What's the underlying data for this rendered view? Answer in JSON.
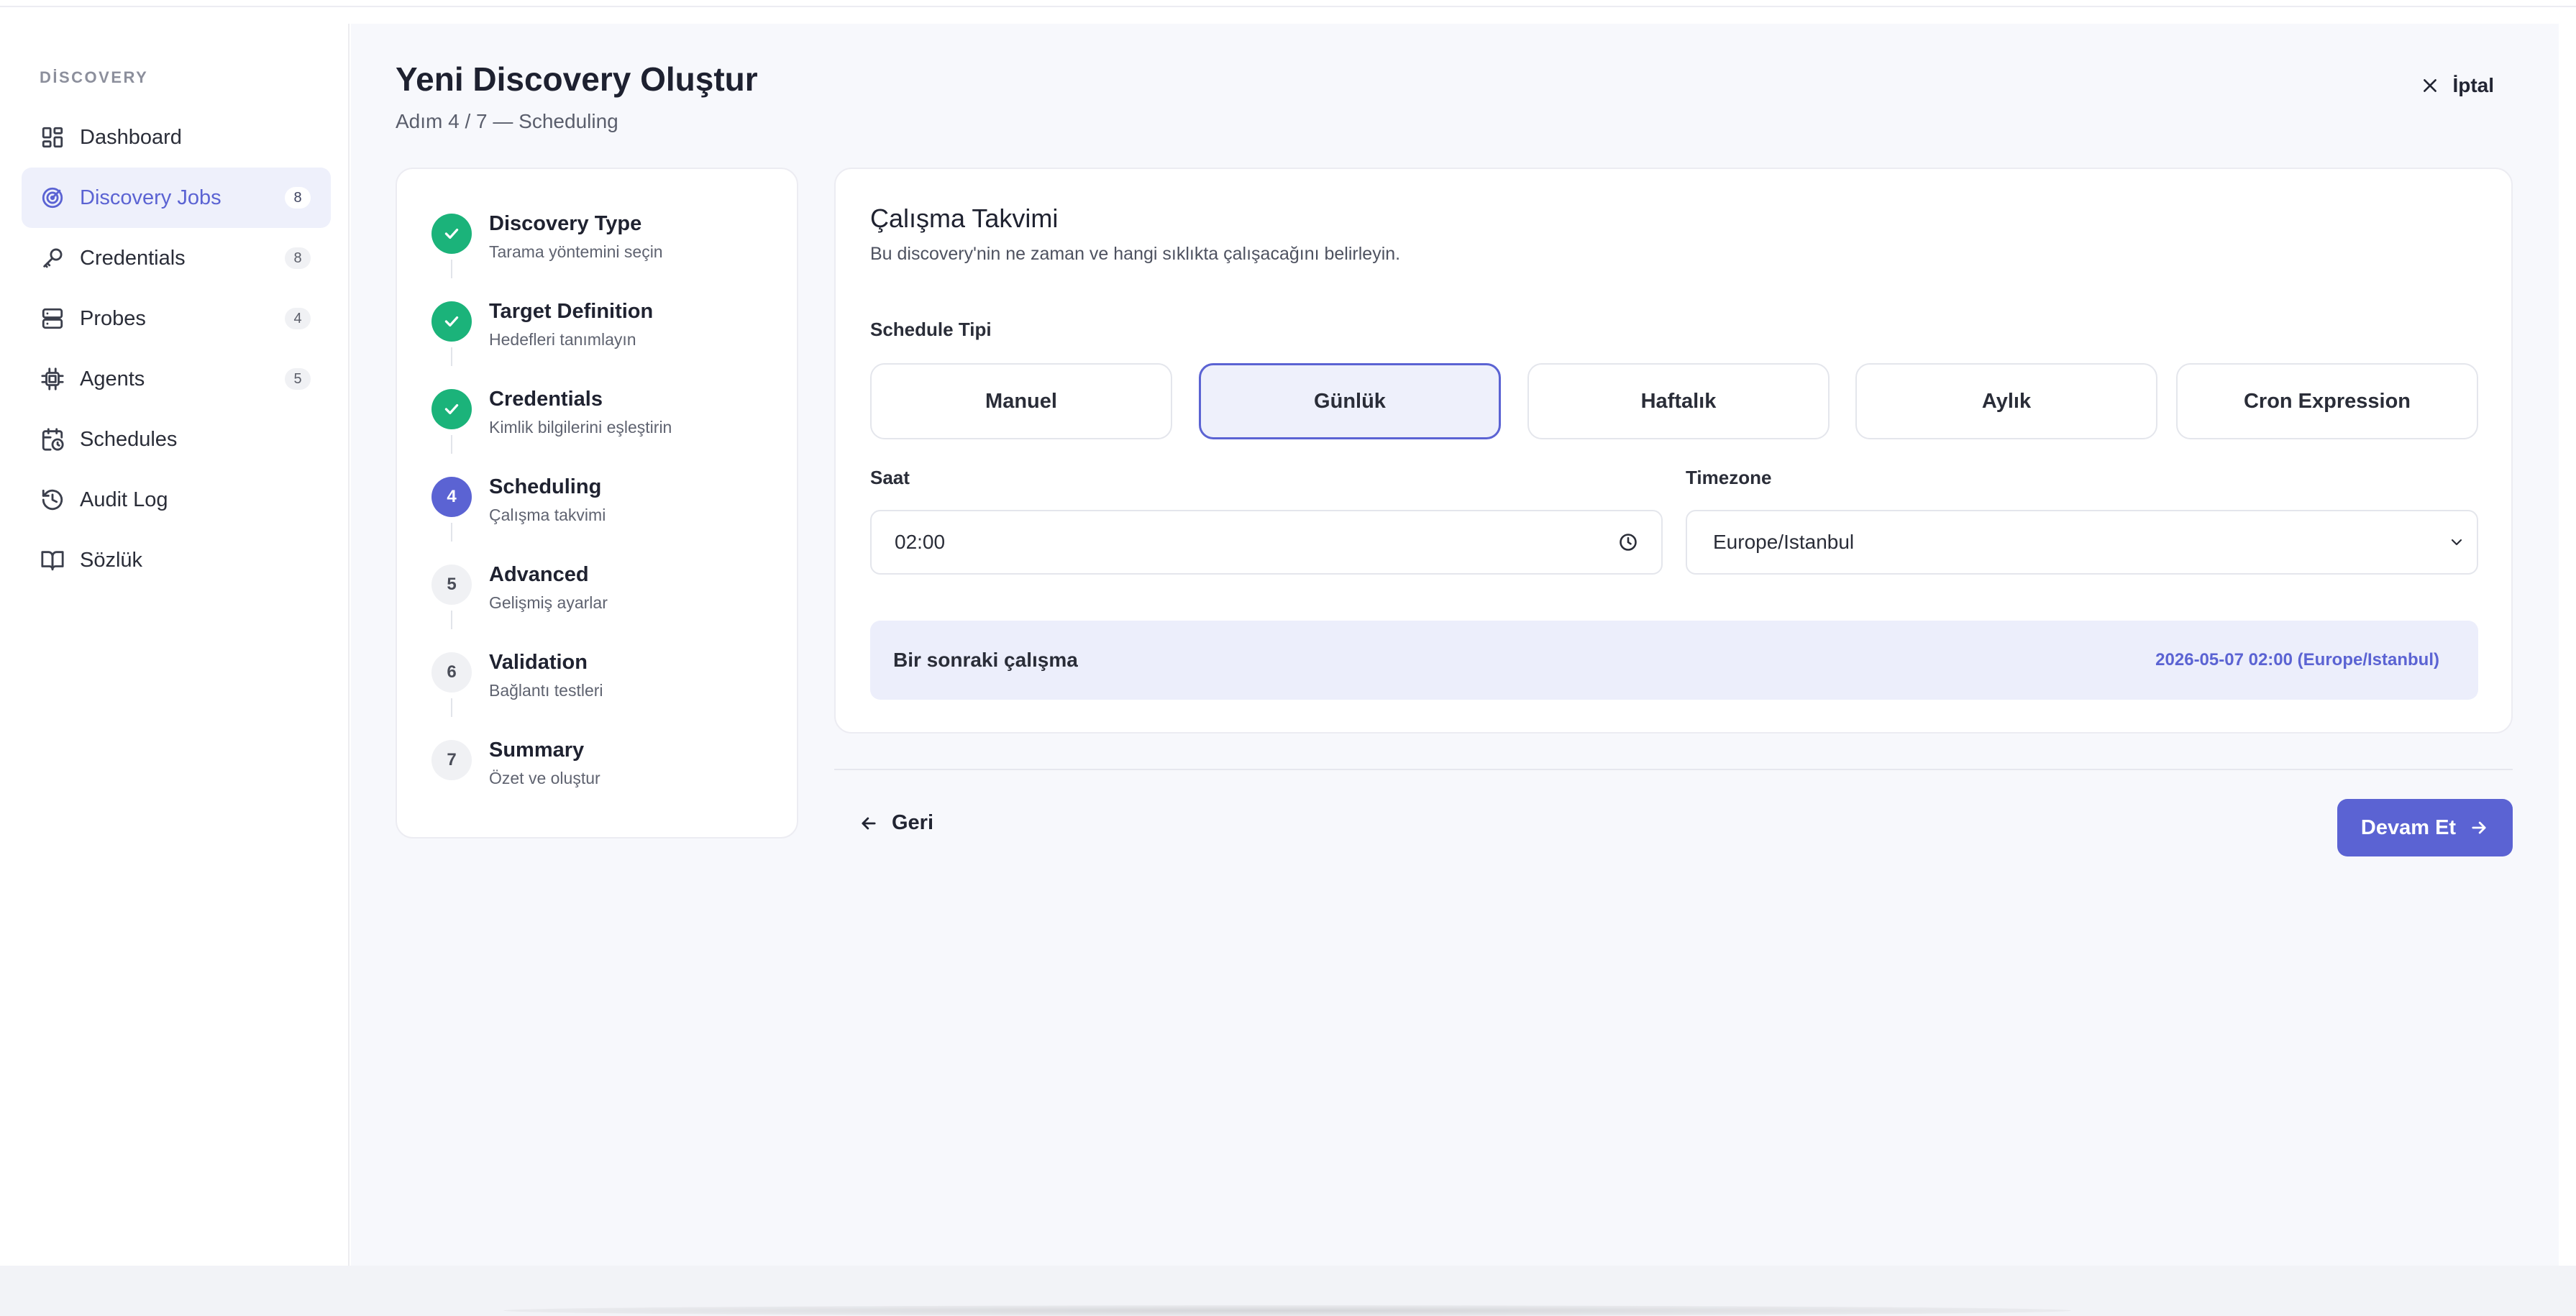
{
  "sidebar": {
    "section_title": "DİSCOVERY",
    "items": [
      {
        "label": "Dashboard",
        "icon": "dashboard-icon",
        "badge": null,
        "active": false
      },
      {
        "label": "Discovery Jobs",
        "icon": "radar-icon",
        "badge": "8",
        "active": true
      },
      {
        "label": "Credentials",
        "icon": "key-icon",
        "badge": "8",
        "active": false
      },
      {
        "label": "Probes",
        "icon": "server-icon",
        "badge": "4",
        "active": false
      },
      {
        "label": "Agents",
        "icon": "chip-icon",
        "badge": "5",
        "active": false
      },
      {
        "label": "Schedules",
        "icon": "calendar-clock-icon",
        "badge": null,
        "active": false
      },
      {
        "label": "Audit Log",
        "icon": "history-icon",
        "badge": null,
        "active": false
      },
      {
        "label": "Sözlük",
        "icon": "book-icon",
        "badge": null,
        "active": false
      }
    ]
  },
  "header": {
    "title": "Yeni Discovery Oluştur",
    "subtitle": "Adım 4 / 7 — Scheduling",
    "cancel_label": "İptal"
  },
  "steps": [
    {
      "number": "1",
      "title": "Discovery Type",
      "desc": "Tarama yöntemini seçin",
      "state": "done"
    },
    {
      "number": "2",
      "title": "Target Definition",
      "desc": "Hedefleri tanımlayın",
      "state": "done"
    },
    {
      "number": "3",
      "title": "Credentials",
      "desc": "Kimlik bilgilerini eşleştirin",
      "state": "done"
    },
    {
      "number": "4",
      "title": "Scheduling",
      "desc": "Çalışma takvimi",
      "state": "current"
    },
    {
      "number": "5",
      "title": "Advanced",
      "desc": "Gelişmiş ayarlar",
      "state": "todo"
    },
    {
      "number": "6",
      "title": "Validation",
      "desc": "Bağlantı testleri",
      "state": "todo"
    },
    {
      "number": "7",
      "title": "Summary",
      "desc": "Özet ve oluştur",
      "state": "todo"
    }
  ],
  "card": {
    "title": "Çalışma Takvimi",
    "description": "Bu discovery'nin ne zaman ve hangi sıklıkta çalışacağını belirleyin.",
    "schedule_type_label": "Schedule Tipi",
    "schedule_options": [
      "Manuel",
      "Günlük",
      "Haftalık",
      "Aylık",
      "Cron Expression"
    ],
    "selected_option": "Günlük",
    "time_label": "Saat",
    "time_value": "02:00",
    "timezone_label": "Timezone",
    "timezone_value": "Europe/Istanbul",
    "next_run_label": "Bir sonraki çalışma",
    "next_run_value": "2026-05-07 02:00 (Europe/Istanbul)"
  },
  "footer": {
    "back_label": "Geri",
    "next_label": "Devam Et"
  },
  "colors": {
    "accent": "#5b63d3",
    "success": "#1bb37a",
    "accent_bg": "#eef0fb"
  }
}
